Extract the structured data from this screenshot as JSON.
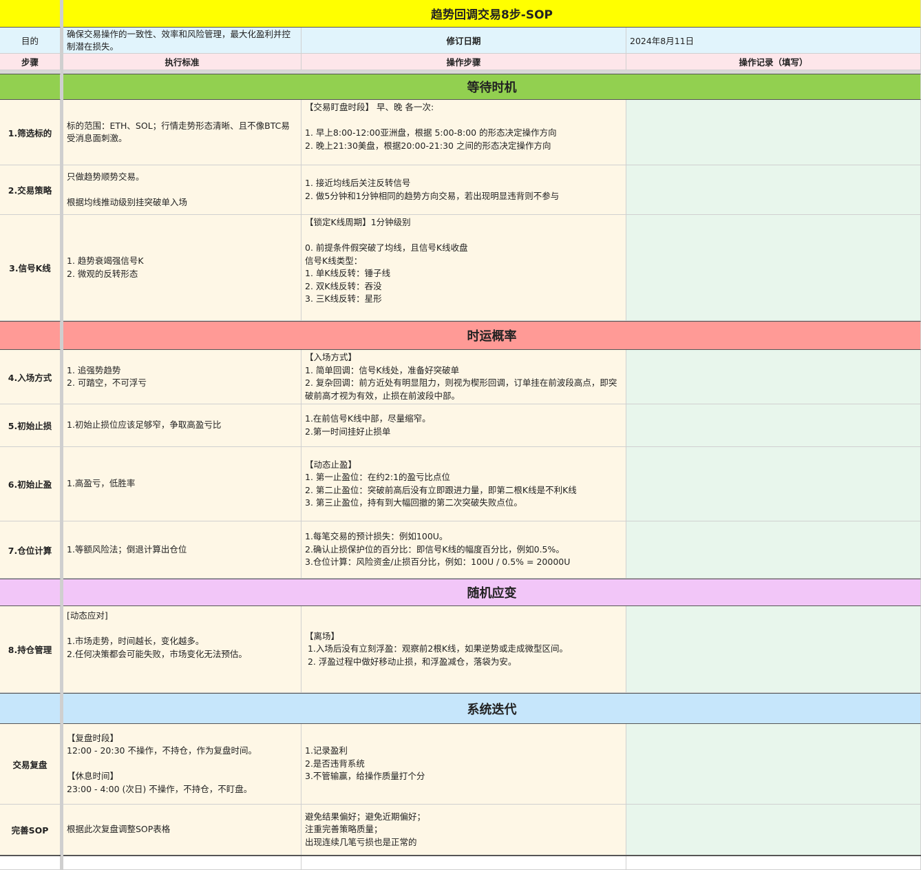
{
  "title": "趋势回调交易8步-SOP",
  "info": {
    "purpose_label": "目的",
    "purpose_text": "确保交易操作的一致性、效率和风险管理，最大化盈利并控制潜在损失。",
    "revision_label": "修订日期",
    "revision_date": "2024年8月11日"
  },
  "headers": {
    "step": "步骤",
    "standard": "执行标准",
    "operation": "操作步骤",
    "record": "操作记录（填写）"
  },
  "sections": {
    "s1": {
      "label": "等待时机",
      "color": "#92d050"
    },
    "s2": {
      "label": "时运概率",
      "color": "#ff9a96"
    },
    "s3": {
      "label": "随机应变",
      "color": "#f2c6f8"
    },
    "s4": {
      "label": "系统迭代",
      "color": "#c6e6fb"
    }
  },
  "rows": {
    "r1": {
      "step": "1.筛选标的",
      "standard": "标的范围：ETH、SOL；行情走势形态清晰、且不像BTC易受消息面刺激。",
      "operation": "【交易盯盘时段】 早、晚 各一次:\n\n1. 早上8:00-12:00亚洲盘，根据 5:00-8:00 的形态决定操作方向\n2. 晚上21:30美盘，根据20:00-21:30 之间的形态决定操作方向"
    },
    "r2": {
      "step": "2.交易策略",
      "standard": "只做趋势顺势交易。\n\n根据均线推动级别挂突破单入场",
      "operation": "1. 接近均线后关注反转信号\n2. 做5分钟和1分钟相同的趋势方向交易，若出现明显违背则不参与"
    },
    "r3": {
      "step": "3.信号K线",
      "standard": "1. 趋势衰竭强信号K\n2. 微观的反转形态",
      "operation": "【锁定K线周期】1分钟级别\n\n0. 前提条件假突破了均线，且信号K线收盘\n信号K线类型：\n1. 单K线反转：锤子线\n2. 双K线反转：吞没\n3. 三K线反转：星形"
    },
    "r4": {
      "step": "4.入场方式",
      "standard": "1. 追强势趋势\n2. 可踏空，不可浮亏",
      "operation": "【入场方式】\n1. 简单回调：信号K线处，准备好突破单\n2. 复杂回调：前方近处有明显阻力，则视为楔形回调，订单挂在前波段高点，即突破前高才视为有效，止损在前波段中部。"
    },
    "r5": {
      "step": "5.初始止损",
      "standard": "1.初始止损位应该足够窄，争取高盈亏比",
      "operation": "1.在前信号K线中部，尽量缩窄。\n2.第一时间挂好止损单"
    },
    "r6": {
      "step": "6.初始止盈",
      "standard": "1.高盈亏，低胜率",
      "operation": "【动态止盈】\n1. 第一止盈位：在约2:1的盈亏比点位\n2. 第二止盈位：突破前高后没有立即跟进力量，即第二根K线是不利K线\n3. 第三止盈位，持有到大幅回撤的第二次突破失败点位。"
    },
    "r7": {
      "step": "7.仓位计算",
      "standard": "1.等额风险法；倒退计算出仓位",
      "operation": "1.每笔交易的预计损失：例如100U。\n2.确认止损保护位的百分比：即信号K线的幅度百分比，例如0.5%。\n3.仓位计算：风险资金/止损百分比，例如：100U / 0.5% = 20000U"
    },
    "r8": {
      "step": "8.持仓管理",
      "standard": "[动态应对]\n\n1.市场走势，时间越长，变化越多。\n2.任何决策都会可能失败，市场变化无法预估。",
      "operation": "【离场】\n 1.入场后没有立刻浮盈：观察前2根K线，如果逆势或走成微型区间。\n 2. 浮盈过程中做好移动止损，和浮盈减仓，落袋为安。"
    },
    "r9": {
      "step": "交易复盘",
      "standard": "【复盘时段】\n12:00 - 20:30 不操作，不持仓，作为复盘时间。\n\n【休息时间】\n23:00 - 4:00 (次日) 不操作，不持仓，不盯盘。",
      "operation": "1.记录盈利\n2.是否违背系统\n3.不管输赢，给操作质量打个分"
    },
    "r10": {
      "step": "完善SOP",
      "standard": "根据此次复盘调整SOP表格",
      "operation": "避免结果偏好；避免近期偏好；\n注重完善策略质量；\n出现连续几笔亏损也是正常的"
    }
  }
}
